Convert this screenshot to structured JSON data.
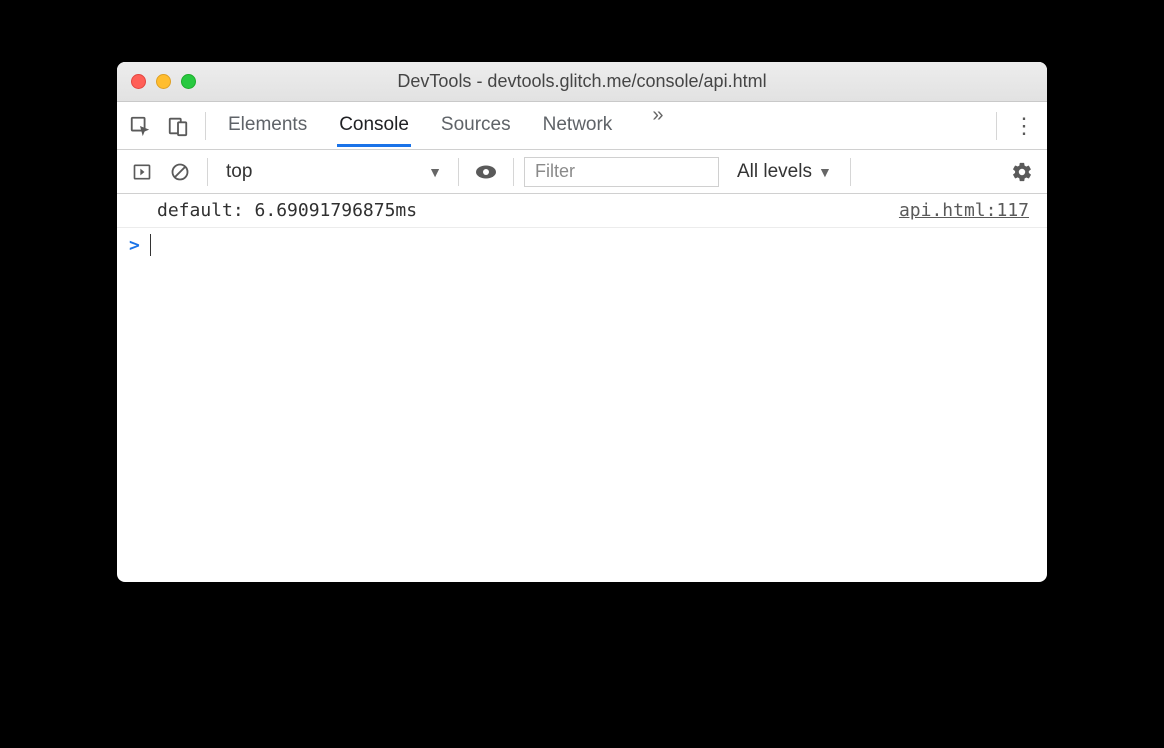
{
  "window": {
    "title": "DevTools - devtools.glitch.me/console/api.html"
  },
  "tabs": {
    "items": [
      "Elements",
      "Console",
      "Sources",
      "Network"
    ],
    "active_index": 1
  },
  "toolbar": {
    "context": "top",
    "filter_placeholder": "Filter",
    "levels_label": "All levels"
  },
  "console": {
    "rows": [
      {
        "message": "default: 6.69091796875ms",
        "source": "api.html:117"
      }
    ],
    "prompt": ">"
  }
}
